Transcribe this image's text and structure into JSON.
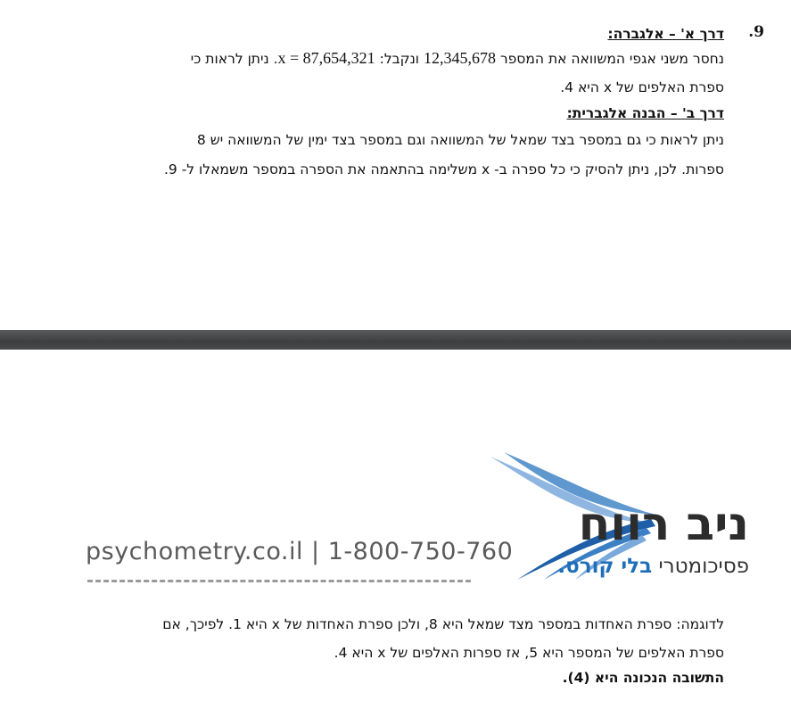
{
  "question": {
    "number": ".9",
    "way_a_title": "דרך א' – אלגברה:",
    "way_a_line1_a": "נחסר משני אגפי המשוואה את המספר ",
    "way_a_num1": "12,345,678",
    "way_a_line1_b": " ונקבל: ",
    "way_a_eq": "x = 87,654,321",
    "way_a_line1_c": ". ניתן לראות כי",
    "way_a_line2": "ספרת האלפים של x היא 4.",
    "way_b_title": "דרך ב' – הבנה אלגברית:",
    "way_b_line1": "ניתן לראות כי גם במספר בצד שמאל של המשוואה וגם במספר בצד ימין של המשוואה יש 8",
    "way_b_line2": "ספרות. לכן, ניתן להסיק כי כל ספרה ב- x משלימה בהתאמה את הספרה במספר משמאלו ל- 9."
  },
  "logo": {
    "url": "psychometry.co.il",
    "divider": "|",
    "phone": "1-800-750-760",
    "brand": "ניב רווח",
    "tagline_plain": "פסיכומטרי ",
    "tagline_accent": "בלי קורס."
  },
  "example": {
    "line1": "לדוגמה: ספרת האחדות במספר מצד שמאל היא 8, ולכן ספרת האחדות של x היא 1. לפיכך, אם",
    "line2": "ספרת האלפים של המספר היא 5, אז ספרות האלפים של x היא 4.",
    "answer": "התשובה הנכונה היא (4)."
  },
  "colors": {
    "separator": "#4a4b4d",
    "brand_blue": "#1f6fb8"
  }
}
